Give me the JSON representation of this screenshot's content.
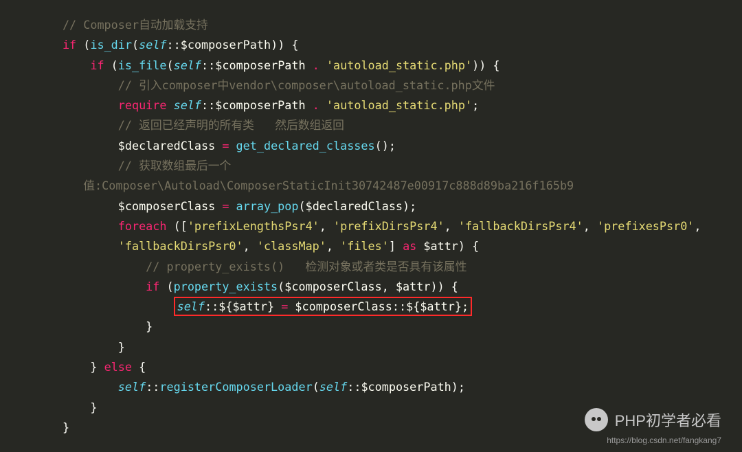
{
  "code": {
    "c1": "// Composer自动加载支持",
    "l2_kw": "if",
    "l2_fn": "is_dir",
    "l2_self": "self",
    "l2_var": "$composerPath",
    "l3_kw": "if",
    "l3_fn": "is_file",
    "l3_self": "self",
    "l3_var": "$composerPath",
    "l3_op": ".",
    "l3_str": "'autoload_static.php'",
    "c4": "// 引入composer中vendor\\composer\\autoload_static.php文件",
    "l5_kw": "require",
    "l5_self": "self",
    "l5_var": "$composerPath",
    "l5_op": ".",
    "l5_str": "'autoload_static.php'",
    "c6": "// 返回已经声明的所有类   然后数组返回",
    "l7_var": "$declaredClass",
    "l7_eq": "=",
    "l7_fn": "get_declared_classes",
    "c8": "// 获取数组最后一个",
    "c9": "值:Composer\\Autoload\\ComposerStaticInit30742487e00917c888d89ba216f165b9",
    "l10_var": "$composerClass",
    "l10_eq": "=",
    "l10_fn": "array_pop",
    "l10_arg": "$declaredClass",
    "l11_kw": "foreach",
    "l11_s1": "'prefixLengthsPsr4'",
    "l11_s2": "'prefixDirsPsr4'",
    "l11_s3": "'fallbackDirsPsr4'",
    "l11_s4": "'prefixesPsr0'",
    "l12_s1": "'fallbackDirsPsr0'",
    "l12_s2": "'classMap'",
    "l12_s3": "'files'",
    "l12_as": "as",
    "l12_var": "$attr",
    "c13": "// property_exists()   检测对象或者类是否具有该属性",
    "l14_kw": "if",
    "l14_fn": "property_exists",
    "l14_a1": "$composerClass",
    "l14_a2": "$attr",
    "hl_self": "self",
    "hl_v1": "${",
    "hl_attr": "$attr",
    "hl_v2": "}",
    "hl_eq": "=",
    "hl_cc": "$composerClass",
    "hl_v3": "${",
    "hl_attr2": "$attr",
    "hl_v4": "};",
    "l19_else": "else",
    "l20_self": "self",
    "l20_fn": "registerComposerLoader",
    "l20_selfb": "self",
    "l20_var": "$composerPath"
  },
  "watermark": {
    "text": "PHP初学者必看",
    "url": "https://blog.csdn.net/fangkang7"
  }
}
